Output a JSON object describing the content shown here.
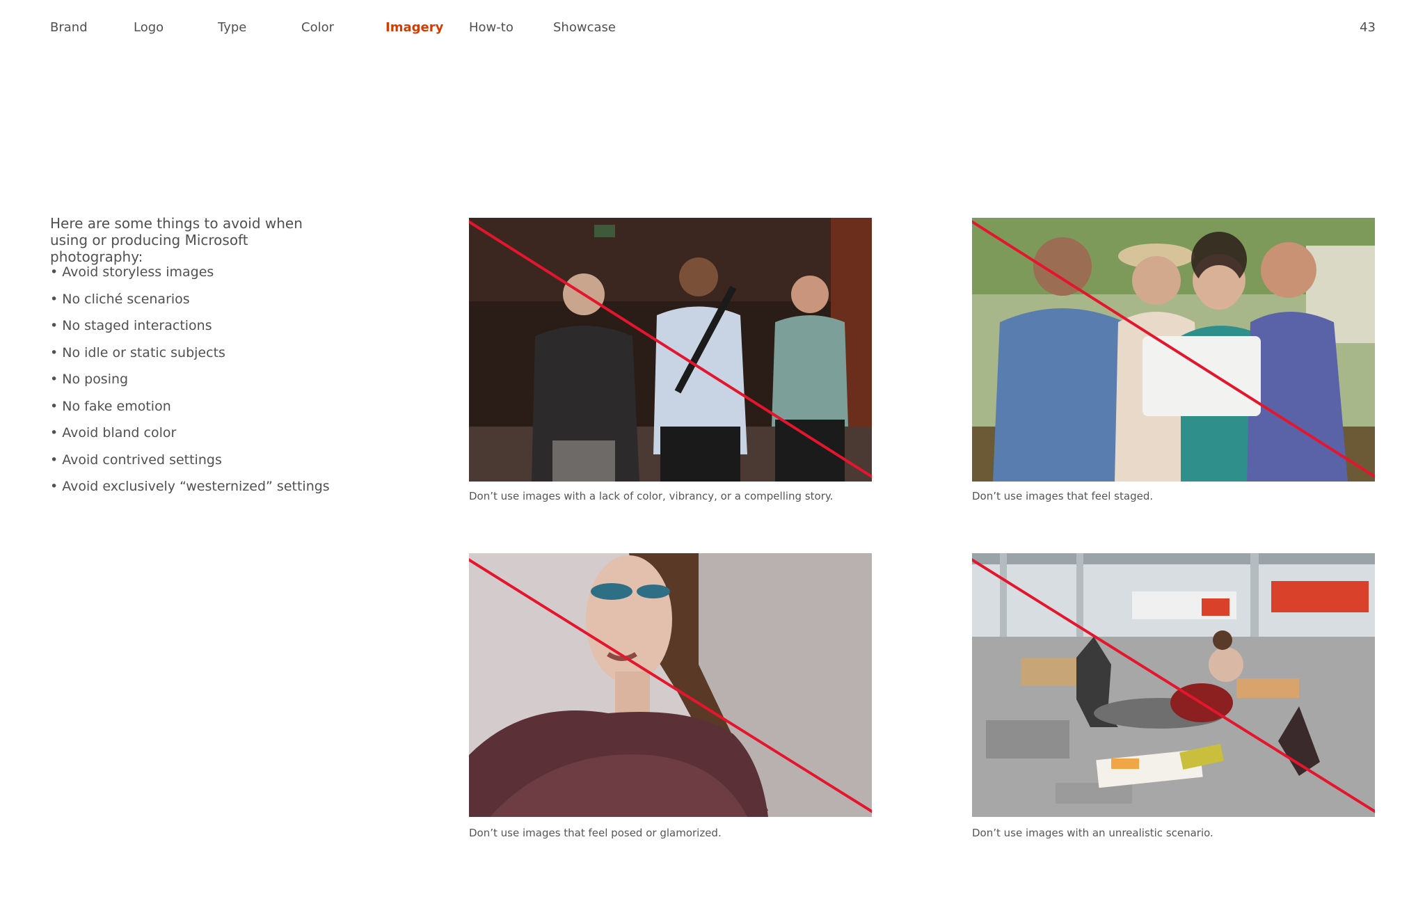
{
  "nav": {
    "items": [
      {
        "label": "Brand",
        "active": false
      },
      {
        "label": "Logo",
        "active": false
      },
      {
        "label": "Type",
        "active": false
      },
      {
        "label": "Color",
        "active": false
      },
      {
        "label": "Imagery",
        "active": true
      },
      {
        "label": "How-to",
        "active": false
      },
      {
        "label": "Showcase",
        "active": false
      }
    ],
    "page_number": "43"
  },
  "intro": {
    "text": "Here are some things to avoid when using or producing Microsoft photography:",
    "bullets": [
      "Avoid storyless images",
      "No cliché scenarios",
      "No staged interactions",
      "No idle or static subjects",
      "No posing",
      "No fake emotion",
      "Avoid bland color",
      "Avoid contrived settings",
      "Avoid exclusively “westernized” settings"
    ]
  },
  "examples": [
    {
      "caption": "Don’t use images with a lack of color, vibrancy, or a compelling story."
    },
    {
      "caption": "Don’t use images that feel staged."
    },
    {
      "caption": "Don’t use images that feel posed or glamorized."
    },
    {
      "caption": "Don’t use images with an unrealistic scenario."
    }
  ],
  "colors": {
    "accent": "#d83b01",
    "strike": "#e3162e",
    "text": "#505050"
  }
}
